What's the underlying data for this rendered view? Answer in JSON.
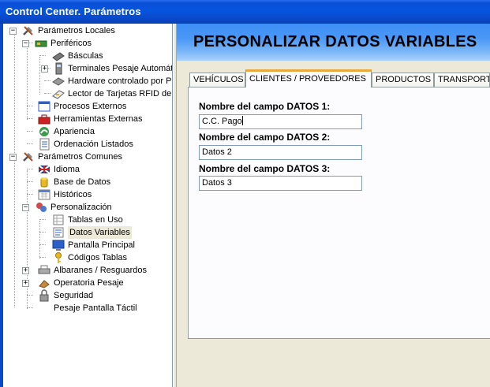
{
  "window": {
    "title": "Control Center. Parámetros"
  },
  "tree": {
    "nodes": [
      {
        "label": "Parámetros Locales",
        "icon": "tools-icon"
      },
      {
        "label": "Periféricos",
        "icon": "card-icon"
      },
      {
        "label": "Básculas",
        "icon": "scale-icon"
      },
      {
        "label": "Terminales Pesaje Automátic",
        "icon": "terminal-icon"
      },
      {
        "label": "Hardware controlado por PL",
        "icon": "hardware-icon"
      },
      {
        "label": "Lector de Tarjetas RFID de",
        "icon": "card-reader-icon"
      },
      {
        "label": "Procesos Externos",
        "icon": "window-icon"
      },
      {
        "label": "Herramientas Externas",
        "icon": "toolbox-icon"
      },
      {
        "label": "Apariencia",
        "icon": "appearance-icon"
      },
      {
        "label": "Ordenación Listados",
        "icon": "sort-list-icon"
      },
      {
        "label": "Parámetros Comunes",
        "icon": "tools-icon"
      },
      {
        "label": "Idioma",
        "icon": "flag-icon"
      },
      {
        "label": "Base de Datos",
        "icon": "database-icon"
      },
      {
        "label": "Históricos",
        "icon": "calendar-icon"
      },
      {
        "label": "Personalización",
        "icon": "personalize-icon"
      },
      {
        "label": "Tablas en Uso",
        "icon": "table-icon"
      },
      {
        "label": "Datos Variables",
        "icon": "data-icon"
      },
      {
        "label": "Pantalla Principal",
        "icon": "monitor-icon"
      },
      {
        "label": "Códigos Tablas",
        "icon": "key-icon"
      },
      {
        "label": "Albaranes / Resguardos",
        "icon": "printer-icon"
      },
      {
        "label": "Operatoria Pesaje",
        "icon": "weight-icon"
      },
      {
        "label": "Seguridad",
        "icon": "lock-icon"
      },
      {
        "label": "Pesaje Pantalla Táctil",
        "icon": "touch-icon"
      }
    ]
  },
  "main": {
    "heading": "PERSONALIZAR DATOS VARIABLES",
    "tabs": [
      {
        "label": "VEHÍCULOS"
      },
      {
        "label": "CLIENTES / PROVEEDORES"
      },
      {
        "label": "PRODUCTOS"
      },
      {
        "label": "TRANSPORT"
      }
    ],
    "fields": [
      {
        "label": "Nombre del campo DATOS 1:",
        "value": "C.C. Pago"
      },
      {
        "label": "Nombre del campo DATOS 2:",
        "value": "Datos 2"
      },
      {
        "label": "Nombre del campo DATOS 3:",
        "value": "Datos 3"
      }
    ]
  },
  "colors": {
    "titlebar": "#0a48c8",
    "header_gradient_top": "#3d8ef7",
    "active_tab_accent": "#e9a93c"
  }
}
